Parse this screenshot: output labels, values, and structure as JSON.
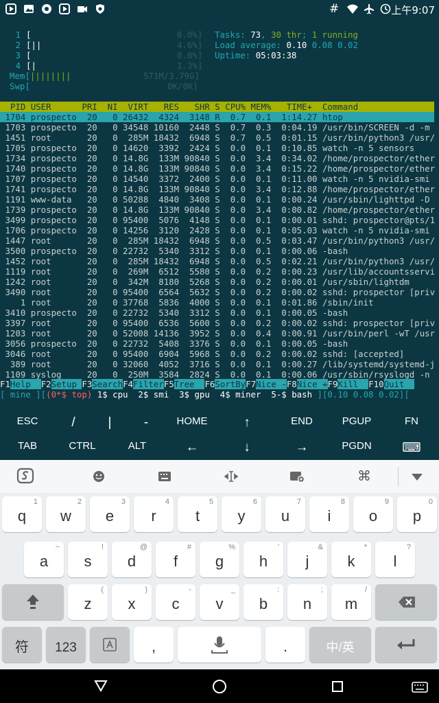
{
  "status_bar": {
    "time": "上午9:07"
  },
  "htop": {
    "cpu_bars": [
      {
        "num": "1",
        "bar": "[",
        "val": "0.0%]",
        "barc": ""
      },
      {
        "num": "2",
        "bar": "[||",
        "val": "4.6%]",
        "barc": "||"
      },
      {
        "num": "3",
        "bar": "[",
        "val": "0.0%]",
        "barc": ""
      },
      {
        "num": "4",
        "bar": "[|",
        "val": "1.3%]",
        "barc": "|"
      }
    ],
    "mem_label": "Mem[",
    "mem_bar": "||||||||",
    "mem_val": "571M/3.79G]",
    "swp_label": "Swp[",
    "swp_val": "0K/0K]",
    "tasks_label": "Tasks: ",
    "tasks_val": "73",
    "tasks_thr": "30 thr",
    "tasks_running": "1 running",
    "load_label": "Load average: ",
    "load1": "0.10",
    "load5": "0.08",
    "load15": "0.02",
    "uptime_label": "Uptime: ",
    "uptime_val": "05:03:38",
    "header": "  PID USER      PRI  NI  VIRT   RES   SHR S CPU% MEM%   TIME+  Command",
    "rows": [
      " 1704 prospecto  20   0 26432  4324  3148 R  0.7  0.1  1:14.27 htop",
      " 1703 prospecto  20   0 34548 10160  2448 S  0.7  0.3  0:04.19 /usr/bin/SCREEN -d -m",
      " 1451 root       20   0  285M 18432  6948 S  0.7  0.5  0:01.15 /usr/bin/python3 /usr/",
      " 1705 prospecto  20   0 14620  3392  2424 S  0.0  0.1  0:10.85 watch -n 5 sensors",
      " 1734 prospecto  20   0 14.8G  133M 90840 S  0.0  3.4  0:34.02 /home/prospector/ether",
      " 1740 prospecto  20   0 14.8G  133M 90840 S  0.0  3.4  0:15.22 /home/prospector/ether",
      " 1707 prospecto  20   0 14540  3372  2400 S  0.0  0.1  0:11.00 watch -n 5 nvidia-smi",
      " 1741 prospecto  20   0 14.8G  133M 90840 S  0.0  3.4  0:12.88 /home/prospector/ether",
      " 1191 www-data   20   0 50288  4840  3408 S  0.0  0.1  0:00.24 /usr/sbin/lighttpd -D",
      " 1739 prospecto  20   0 14.8G  133M 90840 S  0.0  3.4  0:00.82 /home/prospector/ether",
      " 3499 prospecto  20   0 95400  5076  4148 S  0.0  0.1  0:00.01 sshd: prospector@pts/1",
      " 1706 prospecto  20   0 14256  3120  2428 S  0.0  0.1  0:05.03 watch -n 5 nvidia-smi",
      " 1447 root       20   0  285M 18432  6948 S  0.0  0.5  0:03.47 /usr/bin/python3 /usr/",
      " 3500 prospecto  20   0 22732  5340  3312 S  0.0  0.1  0:00.06 -bash",
      " 1452 root       20   0  285M 18432  6948 S  0.0  0.5  0:02.21 /usr/bin/python3 /usr/",
      " 1119 root       20   0  269M  6512  5580 S  0.0  0.2  0:00.23 /usr/lib/accountsservi",
      " 1242 root       20   0  342M  8180  5268 S  0.0  0.2  0:00.01 /usr/sbin/lightdm",
      " 3490 root       20   0 95400  6564  5632 S  0.0  0.2  0:00.02 sshd: prospector [priv",
      "    1 root       20   0 37768  5836  4000 S  0.0  0.1  0:01.86 /sbin/init",
      " 3410 prospecto  20   0 22732  5340  3312 S  0.0  0.1  0:00.05 -bash",
      " 3397 root       20   0 95400  6536  5600 S  0.0  0.2  0:00.02 sshd: prospector [priv",
      " 1203 root       20   0 52008 14136  3952 S  0.0  0.4  0:00.91 /usr/bin/perl -wT /usr",
      " 3056 prospecto  20   0 22732  5408  3376 S  0.0  0.1  0:00.05 -bash",
      " 3046 root       20   0 95400  6904  5968 S  0.0  0.2  0:00.02 sshd: [accepted]",
      "  389 root       20   0 32060  4052  3716 S  0.0  0.1  0:00.27 /lib/systemd/systemd-j",
      " 1109 syslog     20   0  250M  3584  2824 S  0.0  0.1  0:00.06 /usr/sbin/rsyslogd -n"
    ],
    "fkeys": [
      {
        "k": "F1",
        "v": "Help  "
      },
      {
        "k": "F2",
        "v": "Setup "
      },
      {
        "k": "F3",
        "v": "Search"
      },
      {
        "k": "F4",
        "v": "Filter"
      },
      {
        "k": "F5",
        "v": "Tree  "
      },
      {
        "k": "F6",
        "v": "SortBy"
      },
      {
        "k": "F7",
        "v": "Nice -"
      },
      {
        "k": "F8",
        "v": "Nice +"
      },
      {
        "k": "F9",
        "v": "Kill  "
      },
      {
        "k": "F10",
        "v": "Quit  "
      }
    ],
    "screen_bar": {
      "left": "[ mine ][",
      "active": "(0*$ top)",
      "windows": " 1$ cpu  2$ smi  3$ gpu  4$ miner  5-$ bash ",
      "right": "][0.10 0.08 0.02]["
    }
  },
  "extra_keys": {
    "row1": [
      "ESC",
      "/",
      "|",
      "-",
      "HOME",
      "↑",
      "END",
      "PGUP",
      "FN"
    ],
    "row2": [
      "TAB",
      "CTRL",
      "ALT",
      "←",
      "↓",
      "→",
      "PGDN",
      "⌨"
    ]
  },
  "keyboard": {
    "row1": [
      [
        "q",
        "1"
      ],
      [
        "w",
        "2"
      ],
      [
        "e",
        "3"
      ],
      [
        "r",
        "4"
      ],
      [
        "t",
        "5"
      ],
      [
        "y",
        "6"
      ],
      [
        "u",
        "7"
      ],
      [
        "i",
        "8"
      ],
      [
        "o",
        "9"
      ],
      [
        "p",
        "0"
      ]
    ],
    "row2": [
      [
        "a",
        "~"
      ],
      [
        "s",
        "!"
      ],
      [
        "d",
        "@"
      ],
      [
        "f",
        "#"
      ],
      [
        "g",
        "%"
      ],
      [
        "h",
        "'"
      ],
      [
        "j",
        "&"
      ],
      [
        "k",
        "*"
      ],
      [
        "l",
        "?"
      ]
    ],
    "row3": [
      [
        "z",
        "("
      ],
      [
        "x",
        ")"
      ],
      [
        "c",
        "-"
      ],
      [
        "v",
        "_"
      ],
      [
        "b",
        ":"
      ],
      [
        "n",
        ";"
      ],
      [
        "m",
        "/"
      ]
    ],
    "bottom": {
      "fu": "符",
      "num": "123",
      "comma": ",",
      "period": ".",
      "lang": "中/英"
    }
  }
}
